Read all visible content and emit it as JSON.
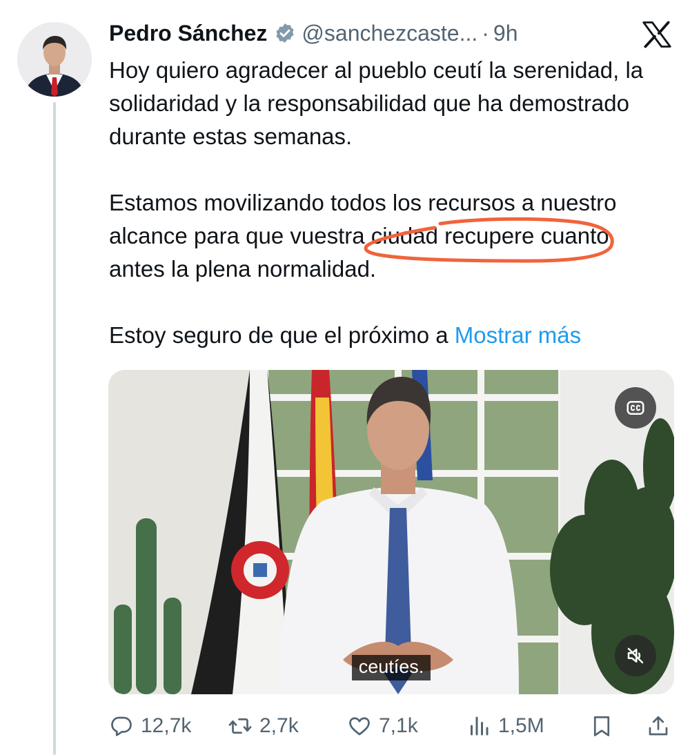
{
  "author": {
    "name": "Pedro Sánchez",
    "handle": "@sanchezcaste...",
    "separator": "·",
    "time": "9h",
    "verified_icon": "verified-badge-icon"
  },
  "platform_icon": "x-logo-icon",
  "tweet": {
    "paragraphs": [
      "Hoy quiero agradecer al pueblo ceutí la serenidad, la solidaridad y la responsabilidad que ha demostrado durante estas semanas.",
      "Estamos movilizando todos los recursos a nuestro alcance para que vuestra ciudad recupere cuanto antes la plena normalidad.",
      "Estoy seguro de que el próximo a"
    ],
    "show_more": "Mostrar más"
  },
  "annotation": {
    "color": "#f0643c"
  },
  "media": {
    "caption": "ceutíes.",
    "cc_icon": "closed-captions-icon",
    "mute_icon": "muted-speaker-icon"
  },
  "actions": {
    "reply_count": "12,7k",
    "retweet_count": "2,7k",
    "like_count": "7,1k",
    "views_count": "1,5M"
  },
  "colors": {
    "text": "#0f1419",
    "secondary": "#536471",
    "link": "#1d9bf0",
    "thread_line": "#cfd9de"
  }
}
